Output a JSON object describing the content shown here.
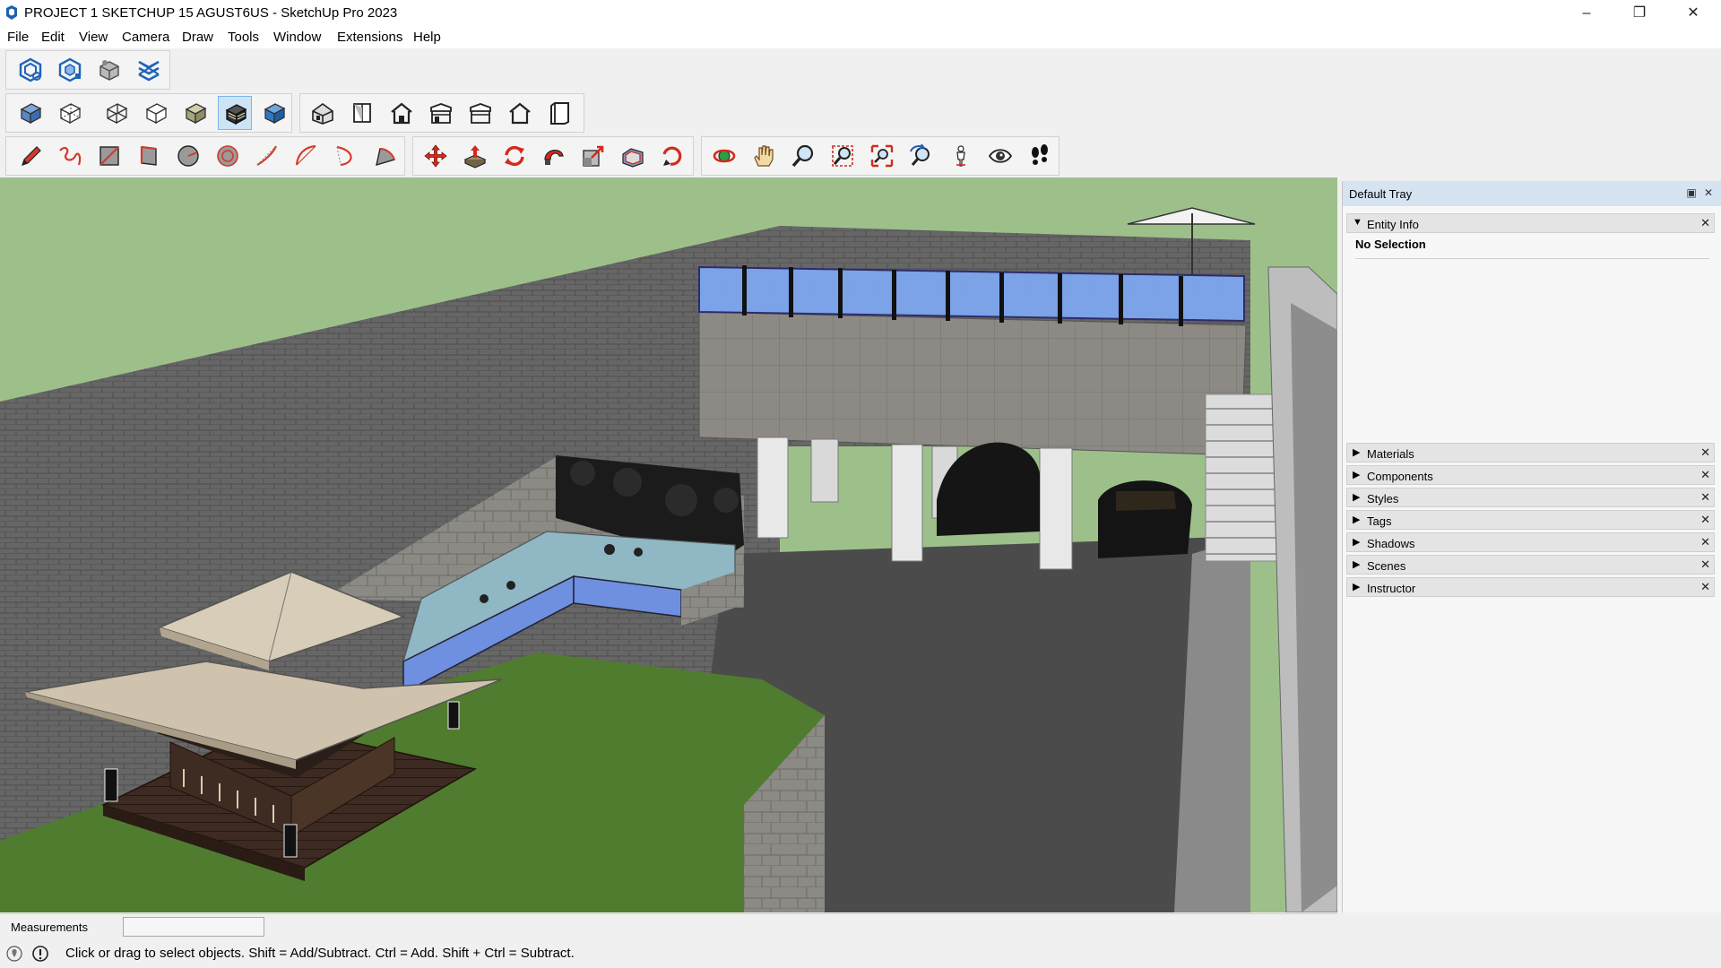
{
  "window": {
    "title": "PROJECT 1 SKETCHUP 15 AGUST6US - SketchUp Pro 2023",
    "controls": [
      "minimize",
      "restore",
      "close"
    ]
  },
  "menu": [
    "File",
    "Edit",
    "View",
    "Camera",
    "Draw",
    "Tools",
    "Window",
    "Extensions",
    "Help"
  ],
  "toolbars": {
    "row1": [
      "3d-warehouse-icon",
      "extension-warehouse-icon",
      "layout-send-icon",
      "extension-manager-icon"
    ],
    "row2_styles": [
      "xray-icon",
      "back-edges-icon",
      "wireframe-icon",
      "hidden-line-icon",
      "shaded-icon",
      "shaded-textures-icon",
      "monochrome-icon"
    ],
    "row2_views": [
      "iso-view-icon",
      "top-view-icon",
      "front-view-icon",
      "right-view-icon",
      "back-view-icon",
      "left-view-icon",
      "parallel-view-icon"
    ],
    "row3_draw": [
      "pencil-icon",
      "freehand-icon",
      "rectangle-icon",
      "rotated-rect-icon",
      "circle-icon",
      "polygon-icon",
      "arc-icon",
      "two-point-arc-icon",
      "three-point-arc-icon",
      "pie-icon"
    ],
    "row3_edit": [
      "move-icon",
      "push-pull-icon",
      "rotate-icon",
      "follow-me-icon",
      "scale-icon",
      "offset-icon",
      "tape-measure-icon"
    ],
    "row3_camera": [
      "orbit-icon",
      "pan-icon",
      "zoom-icon",
      "zoom-window-icon",
      "zoom-extents-icon",
      "previous-view-icon",
      "position-camera-icon",
      "look-around-icon",
      "walk-icon"
    ],
    "active_tool": "shaded-textures-icon"
  },
  "tray": {
    "title": "Default Tray",
    "entity_info": {
      "label": "Entity Info",
      "body": "No Selection"
    },
    "panels": [
      "Materials",
      "Components",
      "Styles",
      "Tags",
      "Shadows",
      "Scenes",
      "Instructor"
    ]
  },
  "measurements": {
    "label": "Measurements",
    "value": ""
  },
  "status": {
    "text": "Click or drag to select objects. Shift = Add/Subtract. Ctrl = Add. Shift + Ctrl = Subtract."
  },
  "colors": {
    "sky": "#9dc08b",
    "wall": "#616161",
    "grass": "#4f7c2e",
    "floor": "#4a4a4a",
    "glass": "#7ea6ef",
    "roof": "#cfc3ad",
    "tray_header": "#d6e3f0"
  }
}
